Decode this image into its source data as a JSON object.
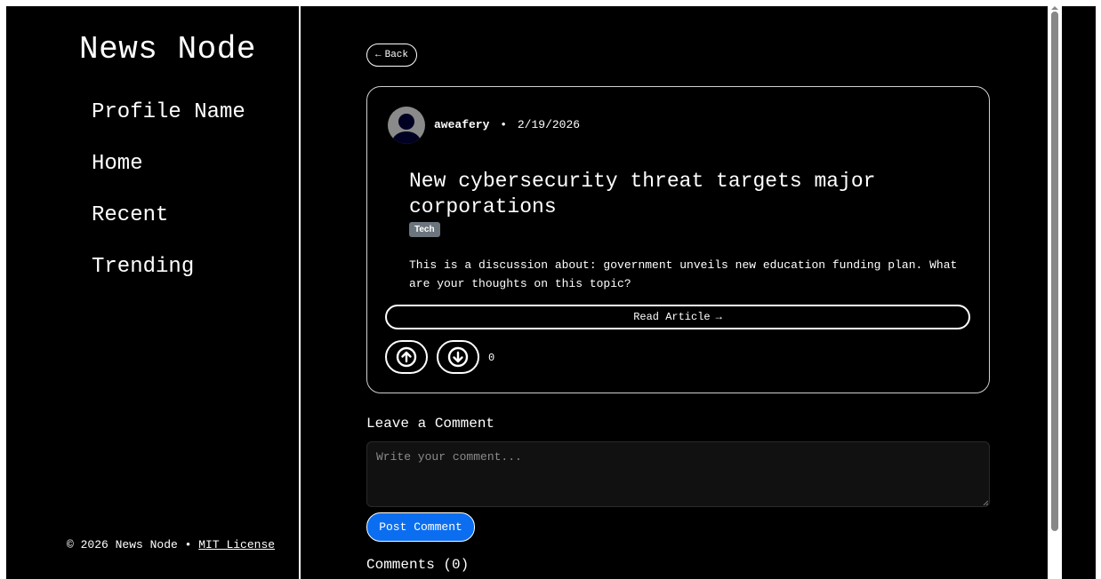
{
  "sidebar": {
    "brand": "News Node",
    "nav": [
      {
        "label": "Profile Name"
      },
      {
        "label": "Home"
      },
      {
        "label": "Recent"
      },
      {
        "label": "Trending"
      }
    ],
    "footer": {
      "copyright": "© 2026 News Node •",
      "license_link": "MIT License"
    }
  },
  "main": {
    "back_label": "Back",
    "back_icon": "arrow-left-icon",
    "post": {
      "author": "aweafery",
      "separator": "•",
      "date": "2/19/2026",
      "title": "New cybersecurity threat targets major corporations",
      "tag": "Tech",
      "body": "This is a discussion about: government unveils new education funding plan. What are your thoughts on this topic?",
      "read_label": "Read Article",
      "read_icon": "arrow-right-icon",
      "vote_count": "0"
    },
    "comment_form": {
      "heading": "Leave a Comment",
      "placeholder": "Write your comment...",
      "submit_label": "Post Comment"
    },
    "comments_heading": "Comments (0)"
  },
  "colors": {
    "background": "#000000",
    "foreground": "#ffffff",
    "accent": "#0b6ef0",
    "tag": "#6c757d"
  }
}
